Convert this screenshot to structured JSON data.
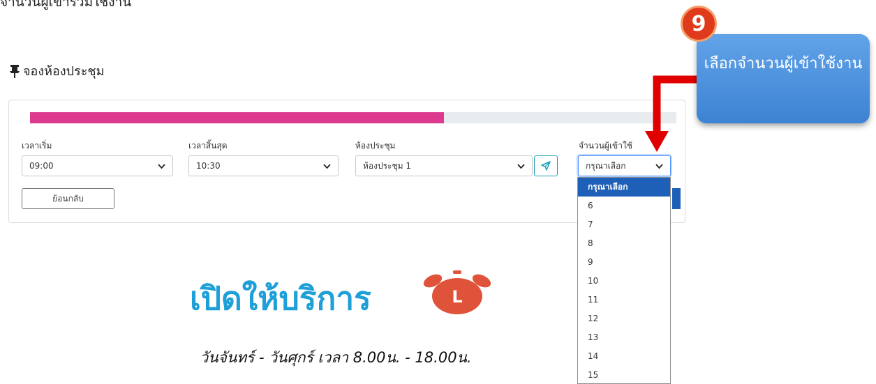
{
  "top_cut_text": "จำนวนผู้เข้าร่วมใช้งาน",
  "page_title": "จองห้องประชุม",
  "progress": {
    "percent": 64,
    "color": "#dc3b8e"
  },
  "fields": {
    "start_time": {
      "label": "เวลาเริ่ม",
      "value": "09:00"
    },
    "end_time": {
      "label": "เวลาสิ้นสุด",
      "value": "10:30"
    },
    "room": {
      "label": "ห้องประชุม",
      "value": "ห้องประชุม 1"
    },
    "attendees": {
      "label": "จำนวนผู้เข้าใช้",
      "value": "กรุณาเลือก"
    }
  },
  "back_button": "ย้อนกลับ",
  "attendee_options": [
    "กรุณาเลือก",
    "6",
    "7",
    "8",
    "9",
    "10",
    "11",
    "12",
    "13",
    "14",
    "15"
  ],
  "open_title": "เปิดให้บริการ",
  "clock_letter": "L",
  "hours_text": "วันจันทร์ - วันศุกร์ เวลา 8.00น. - 18.00น.",
  "callout": {
    "step_number": "9",
    "text": "เลือกจำนวนผู้เข้าใช้งาน"
  },
  "icons": {
    "title": "pin-icon",
    "send": "send-icon",
    "dropdown": "chevron-down-icon",
    "clock": "alarm-clock-icon"
  },
  "colors": {
    "accent_blue": "#1e5fb8",
    "title_cyan": "#1e9fd8",
    "clock_red": "#e0533b",
    "callout_blue": "#4a90dc",
    "arrow_red": "#e00000"
  }
}
